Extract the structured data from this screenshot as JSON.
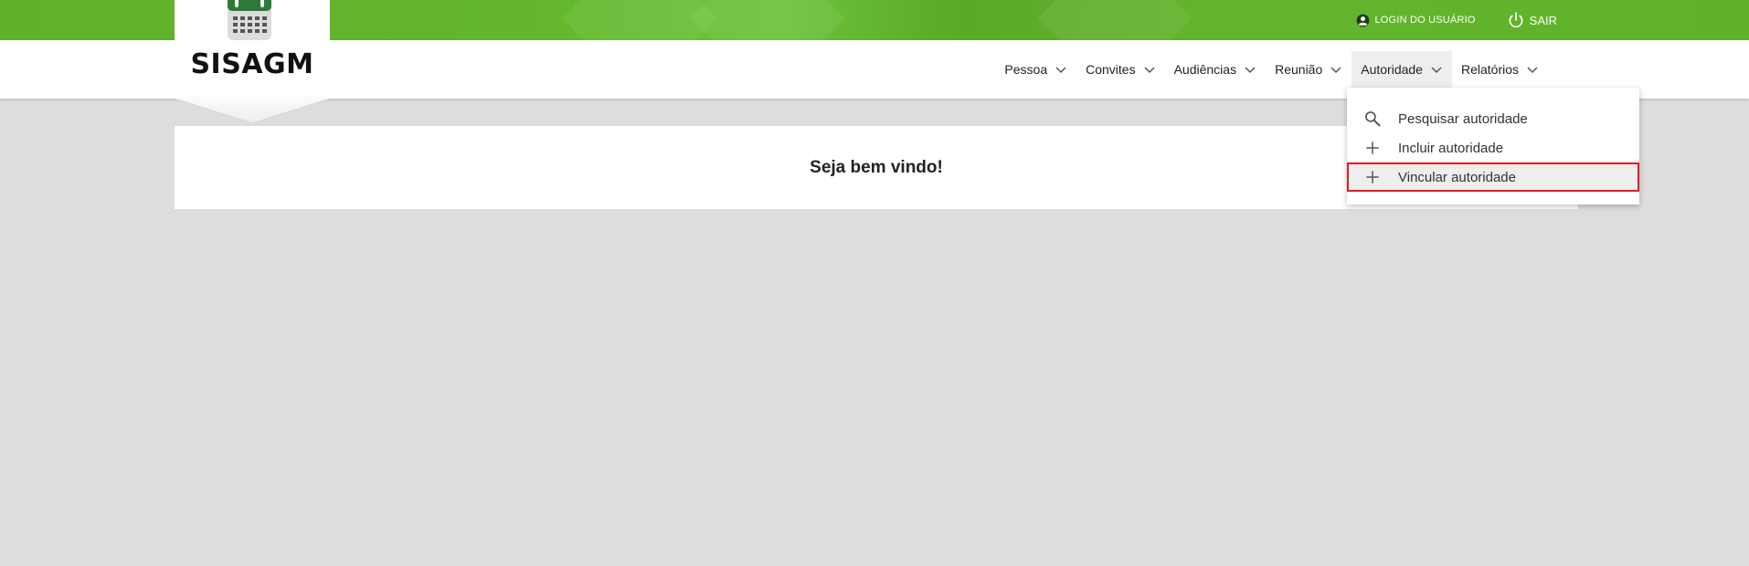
{
  "top_links": {
    "login_label": "LOGIN DO USUÁRIO",
    "logout_label": "SAIR"
  },
  "logo": {
    "title": "SISAGM"
  },
  "menu": {
    "items": [
      {
        "label": "Pessoa"
      },
      {
        "label": "Convites"
      },
      {
        "label": "Audiências"
      },
      {
        "label": "Reunião"
      },
      {
        "label": "Autoridade"
      },
      {
        "label": "Relatórios"
      }
    ]
  },
  "dropdown": {
    "items": [
      {
        "label": "Pesquisar autoridade",
        "icon": "search-icon"
      },
      {
        "label": "Incluir autoridade",
        "icon": "plus-icon"
      },
      {
        "label": "Vincular autoridade",
        "icon": "plus-icon"
      }
    ]
  },
  "content": {
    "welcome": "Seja bem vindo!"
  },
  "colors": {
    "brand_green": "#5fb12a",
    "background": "#dddddd",
    "highlight_border": "#e01b24"
  }
}
